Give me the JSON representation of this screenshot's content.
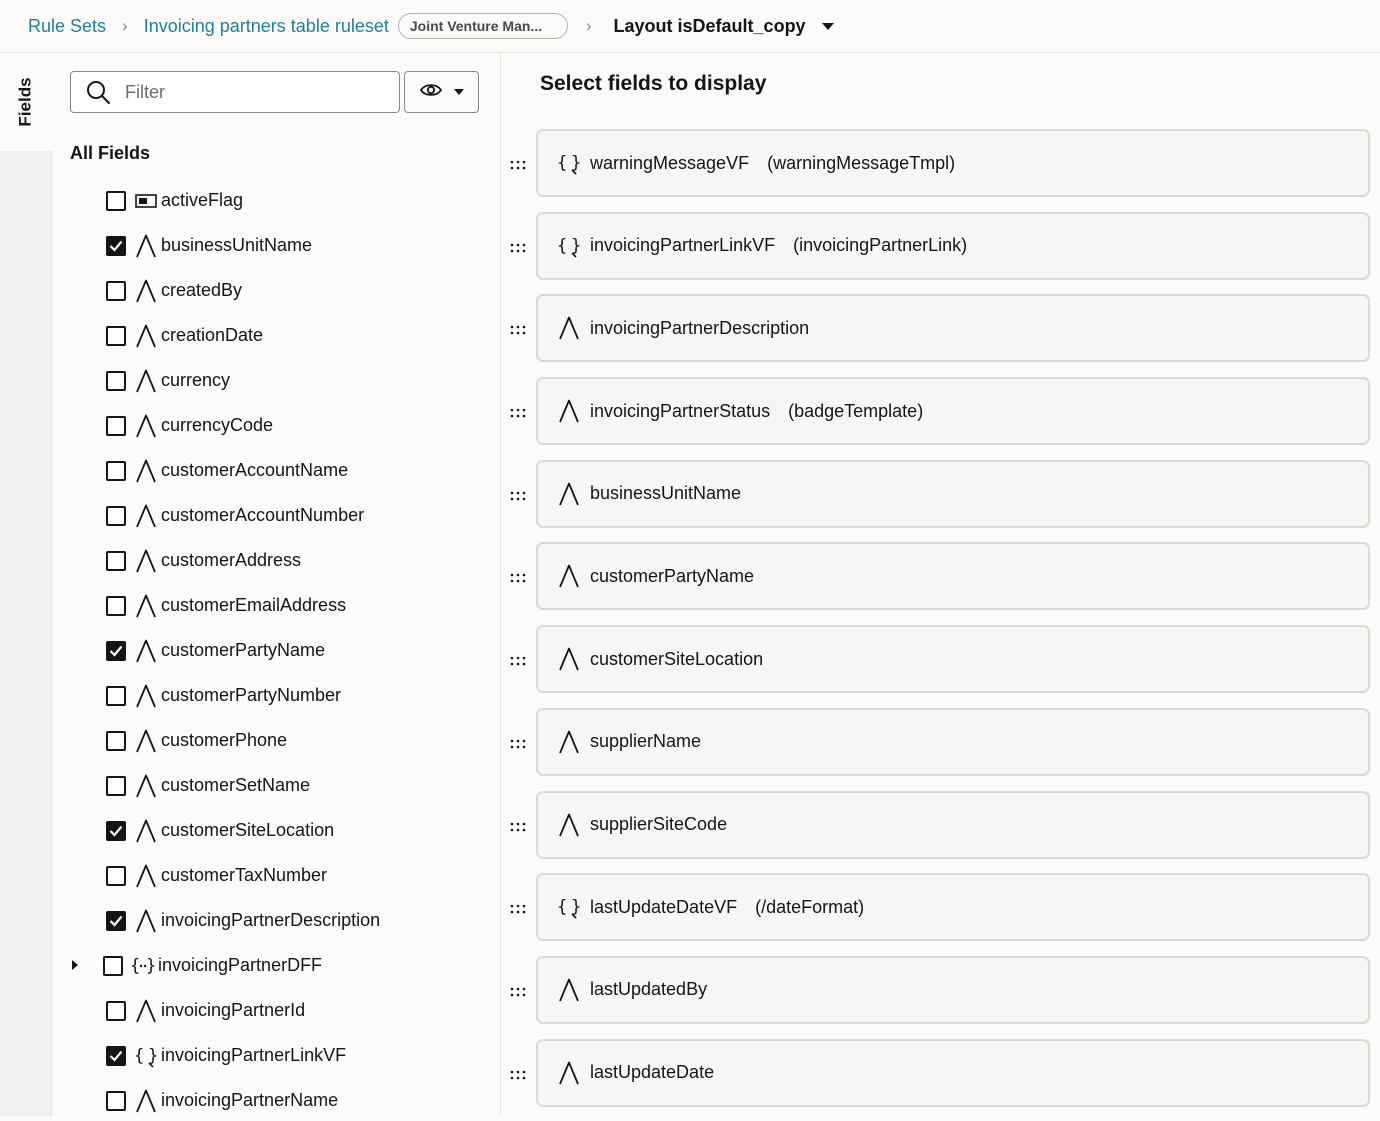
{
  "breadcrumb": {
    "rule_sets": "Rule Sets",
    "ruleset": "Invoicing partners table ruleset",
    "badge": "Joint Venture Man...",
    "layout": "Layout isDefault_copy"
  },
  "rail": {
    "tab_label": "Fields"
  },
  "left": {
    "filter_placeholder": "Filter",
    "view_icon": "eye-icon",
    "all_fields_label": "All Fields",
    "fields": [
      {
        "name": "activeFlag",
        "icon": "boolean",
        "checked": false,
        "expandable": false
      },
      {
        "name": "businessUnitName",
        "icon": "text",
        "checked": true,
        "expandable": false
      },
      {
        "name": "createdBy",
        "icon": "text",
        "checked": false,
        "expandable": false
      },
      {
        "name": "creationDate",
        "icon": "text",
        "checked": false,
        "expandable": false
      },
      {
        "name": "currency",
        "icon": "text",
        "checked": false,
        "expandable": false
      },
      {
        "name": "currencyCode",
        "icon": "text",
        "checked": false,
        "expandable": false
      },
      {
        "name": "customerAccountName",
        "icon": "text",
        "checked": false,
        "expandable": false
      },
      {
        "name": "customerAccountNumber",
        "icon": "text",
        "checked": false,
        "expandable": false
      },
      {
        "name": "customerAddress",
        "icon": "text",
        "checked": false,
        "expandable": false
      },
      {
        "name": "customerEmailAddress",
        "icon": "text",
        "checked": false,
        "expandable": false
      },
      {
        "name": "customerPartyName",
        "icon": "text",
        "checked": true,
        "expandable": false
      },
      {
        "name": "customerPartyNumber",
        "icon": "text",
        "checked": false,
        "expandable": false
      },
      {
        "name": "customerPhone",
        "icon": "text",
        "checked": false,
        "expandable": false
      },
      {
        "name": "customerSetName",
        "icon": "text",
        "checked": false,
        "expandable": false
      },
      {
        "name": "customerSiteLocation",
        "icon": "text",
        "checked": true,
        "expandable": false
      },
      {
        "name": "customerTaxNumber",
        "icon": "text",
        "checked": false,
        "expandable": false
      },
      {
        "name": "invoicingPartnerDescription",
        "icon": "text",
        "checked": true,
        "expandable": false
      },
      {
        "name": "invoicingPartnerDFF",
        "icon": "object",
        "checked": false,
        "expandable": true
      },
      {
        "name": "invoicingPartnerId",
        "icon": "text",
        "checked": false,
        "expandable": false
      },
      {
        "name": "invoicingPartnerLinkVF",
        "icon": "virtual",
        "checked": true,
        "expandable": false
      },
      {
        "name": "invoicingPartnerName",
        "icon": "text",
        "checked": false,
        "expandable": false
      }
    ]
  },
  "right": {
    "title": "Select fields to display",
    "selected": [
      {
        "name": "warningMessageVF",
        "template": "(warningMessageTmpl)",
        "icon": "virtual"
      },
      {
        "name": "invoicingPartnerLinkVF",
        "template": "(invoicingPartnerLink)",
        "icon": "virtual"
      },
      {
        "name": "invoicingPartnerDescription",
        "template": "",
        "icon": "text"
      },
      {
        "name": "invoicingPartnerStatus",
        "template": "(badgeTemplate)",
        "icon": "text"
      },
      {
        "name": "businessUnitName",
        "template": "",
        "icon": "text"
      },
      {
        "name": "customerPartyName",
        "template": "",
        "icon": "text"
      },
      {
        "name": "customerSiteLocation",
        "template": "",
        "icon": "text"
      },
      {
        "name": "supplierName",
        "template": "",
        "icon": "text"
      },
      {
        "name": "supplierSiteCode",
        "template": "",
        "icon": "text"
      },
      {
        "name": "lastUpdateDateVF",
        "template": "(/dateFormat)",
        "icon": "virtual"
      },
      {
        "name": "lastUpdatedBy",
        "template": "",
        "icon": "text"
      },
      {
        "name": "lastUpdateDate",
        "template": "",
        "icon": "text"
      }
    ]
  },
  "colors": {
    "link": "#227e9e",
    "text": "#161513",
    "card_bg": "#f7f6f5",
    "card_border": "#dcd9d5",
    "rail_bg": "#f1efed"
  }
}
